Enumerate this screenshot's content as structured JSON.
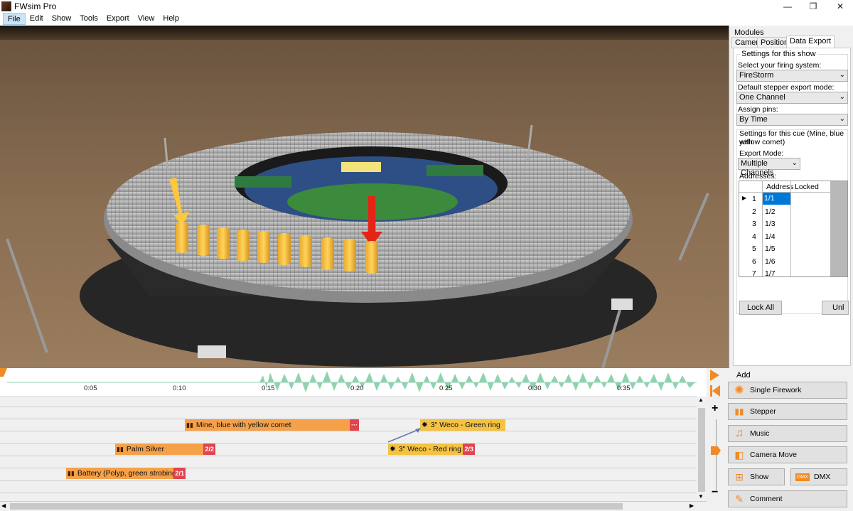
{
  "window": {
    "title": "FWsim Pro",
    "minimize": "—",
    "maximize": "❐",
    "close": "✕"
  },
  "menu": [
    "File",
    "Edit",
    "Show",
    "Tools",
    "Export",
    "View",
    "Help"
  ],
  "modules": {
    "label": "Modules",
    "tabs": [
      "Camera",
      "Positions",
      "Data Export"
    ],
    "active_tab": "Data Export",
    "show_settings": {
      "title": "Settings for this show",
      "firing_system_label": "Select your firing system:",
      "firing_system_value": "FireStorm",
      "stepper_label": "Default stepper export mode:",
      "stepper_value": "One Channel",
      "assign_pins_label": "Assign pins:",
      "assign_pins_value": "By Time"
    },
    "cue_settings": {
      "title_line1": "Settings for this cue (Mine, blue with",
      "title_line2": "yellow comet)",
      "export_mode_label": "Export Mode:",
      "export_mode_value": "Multiple Channels",
      "addresses_label": "Addresses:",
      "columns": [
        "Address",
        "Locked"
      ],
      "rows": [
        {
          "n": "1",
          "address": "1/1"
        },
        {
          "n": "2",
          "address": "1/2"
        },
        {
          "n": "3",
          "address": "1/3"
        },
        {
          "n": "4",
          "address": "1/4"
        },
        {
          "n": "5",
          "address": "1/5"
        },
        {
          "n": "6",
          "address": "1/6"
        },
        {
          "n": "7",
          "address": "1/7"
        }
      ],
      "lock_all": "Lock All",
      "unlock": "Unl"
    }
  },
  "timeline": {
    "ticks": [
      "0:05",
      "0:10",
      "0:15",
      "0:20",
      "0:25",
      "0:30",
      "0:35"
    ],
    "cues": [
      {
        "label": "Mine, blue with yellow comet",
        "badge": "···"
      },
      {
        "label": "3\" Weco - Green ring",
        "badge": ""
      },
      {
        "label": "Palm Silver",
        "badge": "2/2"
      },
      {
        "label": "3\" Weco - Red ring",
        "badge": "2/3"
      },
      {
        "label": "Battery (Polyp, green strobing)",
        "badge": "2/1"
      }
    ]
  },
  "add_panel": {
    "title": "Add",
    "buttons": [
      "Single Firework",
      "Stepper",
      "Music",
      "Camera Move",
      "Show",
      "DMX",
      "Comment"
    ]
  },
  "colors": {
    "accent": "#f08a24",
    "cue": "#f5a14a",
    "cue_selected": "#f5c242",
    "badge": "#e1444e",
    "wave": "#8fd3ae"
  }
}
